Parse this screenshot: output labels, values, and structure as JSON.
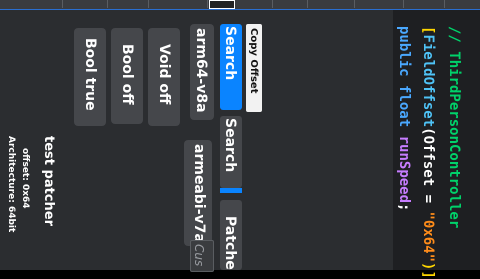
{
  "code": {
    "comment": "// ThirdPersonController",
    "attr_open": "[",
    "attr_name": "FieldOffset",
    "attr_args_start": "(Offset = ",
    "attr_value": "\"0x64\"",
    "attr_close": ")]",
    "decl_public": "public",
    "decl_type": "float",
    "decl_name": "runSpeed",
    "decl_end": ";"
  },
  "toolbar": {
    "copy_offset_label": "Copy Offset"
  },
  "tabs": [
    {
      "label": "Search",
      "active": true
    },
    {
      "label": "Search",
      "active": false
    },
    {
      "label": "Patche",
      "active": false
    }
  ],
  "arch_buttons": {
    "arm64": "arm64-v8a",
    "armeabi": "armeabi-v7a"
  },
  "custom_input": {
    "placeholder": "Cus"
  },
  "actions": {
    "void_off": "Void off",
    "bool_off": "Bool off",
    "bool_true": "Bool true"
  },
  "info": {
    "title": "test patcher",
    "offset": "offset: 0x64",
    "architecture": "Architecture: 64bit"
  },
  "colors": {
    "comment": "#00d26a",
    "bracket": "#ffd600",
    "attr": "#4fc3f7",
    "string": "#ff8c1a",
    "keyword": "#4aa8ff",
    "ident": "#c77dff",
    "accent": "#0a84ff"
  }
}
